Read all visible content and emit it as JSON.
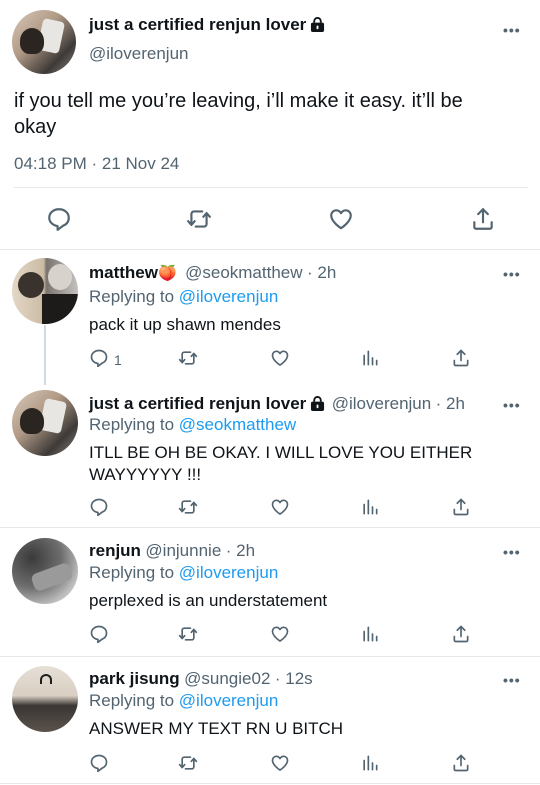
{
  "main_tweet": {
    "display_name": "just a certified renjun lover",
    "handle": "@iloverenjun",
    "text_line1": "if you tell me you’re leaving, i’ll make it easy. it’ll be",
    "text_line2": "okay",
    "timestamp": "04:18 PM · 21 Nov 24"
  },
  "replies": [
    {
      "display_name": "matthew",
      "emoji": "🍑",
      "handle": "@seokmatthew",
      "time": "· 2h",
      "replying_prefix": "Replying to",
      "replying_to": "@iloverenjun",
      "text": "pack it up shawn mendes",
      "reply_count": "1"
    },
    {
      "display_name": "just a certified renjun lover",
      "handle": "@iloverenjun",
      "time": "· 2h",
      "replying_prefix": "Replying to",
      "replying_to": "@seokmatthew",
      "text_line1": "ITLL BE OH BE OKAY. I WILL LOVE YOU EITHER",
      "text_line2": "WAYYYYYY !!!"
    },
    {
      "display_name": "renjun",
      "handle": "@injunnie",
      "time": "· 2h",
      "replying_prefix": "Replying to",
      "replying_to": "@iloverenjun",
      "text": "perplexed is an understatement"
    },
    {
      "display_name": "park jisung",
      "handle": "@sungie02",
      "time": "· 12s",
      "replying_prefix": "Replying to",
      "replying_to": "@iloverenjun",
      "text": "ANSWER MY TEXT RN U BITCH"
    }
  ],
  "more_label": "•••",
  "colors": {
    "link": "#1d9bf0",
    "secondary": "#536471",
    "divider": "#e6e8eb"
  }
}
